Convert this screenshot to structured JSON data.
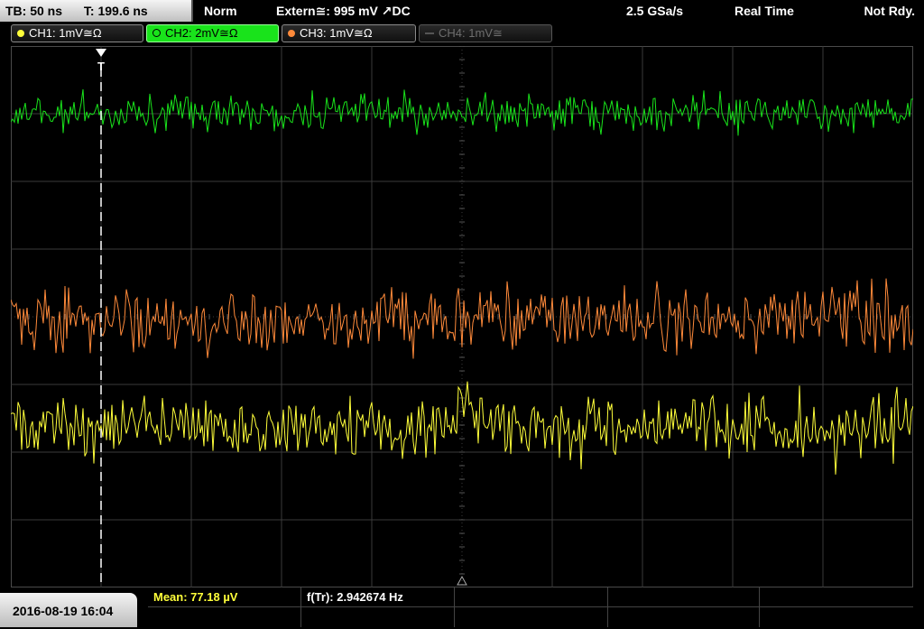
{
  "topbar": {
    "timebase": "TB: 50 ns",
    "trigger_time": "T: 199.6 ns",
    "trigger_mode": "Norm",
    "trigger_source": "Extern≅: 995 mV ↗DC",
    "sample_rate": "2.5 GSa/s",
    "acquisition_mode": "Real Time",
    "status": "Not Rdy."
  },
  "channels": [
    {
      "label": "CH1: 1mV≅Ω",
      "color": "#ffff3a",
      "active": true
    },
    {
      "label": "CH2: 2mV≅Ω",
      "color": "#19e31b",
      "active": true,
      "selected": true
    },
    {
      "label": "CH3: 1mV≅Ω",
      "color": "#ff8a3a",
      "active": true
    },
    {
      "label": "CH4: 1mV≅",
      "color": "#6e6e6e",
      "active": false
    }
  ],
  "trigger_marker": "T",
  "datetime": "2016-08-19 16:04",
  "measurements": {
    "mean": "Mean: 77.18 µV",
    "frequency": "f(Tr): 2.942674 Hz"
  },
  "colors": {
    "ch1": "#ffff3a",
    "ch2": "#19e31b",
    "ch3": "#ff8a3a",
    "grid": "#3a3a3a",
    "background": "#000000"
  }
}
